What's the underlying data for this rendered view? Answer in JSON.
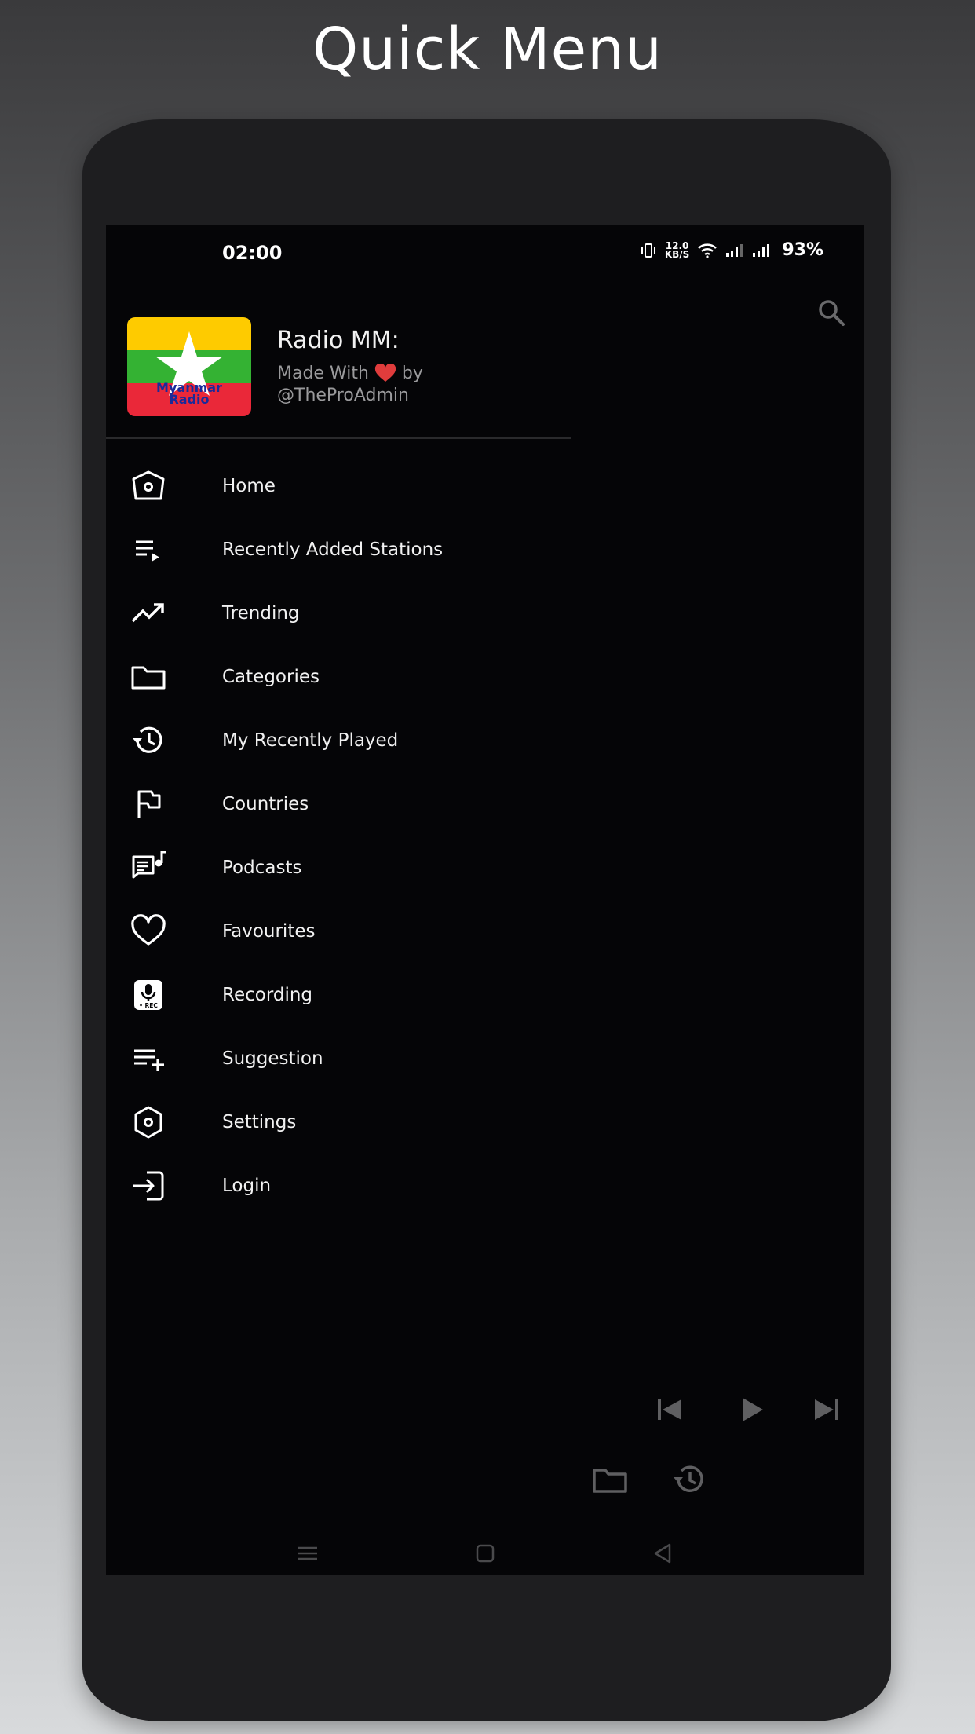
{
  "banner": {
    "title": "Quick Menu"
  },
  "status_bar": {
    "time": "02:00",
    "net_speed_value": "12.0",
    "net_speed_unit": "KB/S",
    "battery": "93%"
  },
  "drawer": {
    "app_name": "Radio MM:",
    "made_with": "Made With",
    "by": "by",
    "author": "@TheProAdmin",
    "logo_text_line1": "Myanmar",
    "logo_text_line2": "Radio",
    "items": [
      {
        "label": "Home",
        "icon": "home-icon"
      },
      {
        "label": "Recently Added Stations",
        "icon": "playlist-play-icon"
      },
      {
        "label": "Trending",
        "icon": "trending-up-icon"
      },
      {
        "label": "Categories",
        "icon": "folder-icon"
      },
      {
        "label": "My Recently Played",
        "icon": "history-icon"
      },
      {
        "label": "Countries",
        "icon": "flag-icon"
      },
      {
        "label": "Podcasts",
        "icon": "podcast-icon"
      },
      {
        "label": "Favourites",
        "icon": "heart-icon"
      },
      {
        "label": "Recording",
        "icon": "record-icon"
      },
      {
        "label": "Suggestion",
        "icon": "playlist-add-icon"
      },
      {
        "label": "Settings",
        "icon": "settings-icon"
      },
      {
        "label": "Login",
        "icon": "login-icon"
      }
    ]
  },
  "colors": {
    "screen_bg": "#050507",
    "text": "#f1f1f1",
    "subtext": "#9a9a9c",
    "player_icon": "#5a5a5c",
    "flag_yellow": "#fecb00",
    "flag_green": "#34b233",
    "flag_red": "#ea2839"
  }
}
